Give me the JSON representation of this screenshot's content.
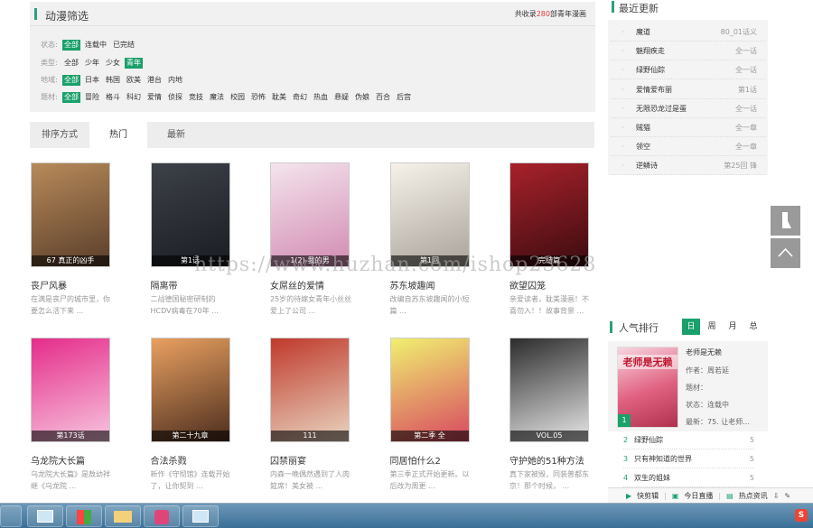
{
  "filter": {
    "title": "动漫筛选",
    "total_prefix": "共收录",
    "total_count": "280",
    "total_suffix": "部青年漫画",
    "rows": [
      {
        "label": "状态:",
        "options": [
          "全部",
          "连载中",
          "已完结"
        ],
        "selected": 0
      },
      {
        "label": "类型:",
        "options": [
          "全部",
          "少年",
          "少女",
          "青年"
        ],
        "selected": 3
      },
      {
        "label": "地域:",
        "options": [
          "全部",
          "日本",
          "韩国",
          "欧美",
          "港台",
          "内地"
        ],
        "selected": 0
      },
      {
        "label": "题材:",
        "options": [
          "全部",
          "冒险",
          "格斗",
          "科幻",
          "爱情",
          "侦探",
          "竞技",
          "魔法",
          "校园",
          "恐怖",
          "耽美",
          "奇幻",
          "热血",
          "悬疑",
          "伪娘",
          "百合",
          "后宫"
        ],
        "selected": 0
      }
    ]
  },
  "sort": {
    "label": "排序方式",
    "tabs": [
      "热门",
      "最新"
    ],
    "active": 0
  },
  "comics": [
    {
      "title": "丧尸风暴",
      "tag": "67 真正的凶手",
      "desc": "在满是丧尸的城市里，你要怎么活下来 ...",
      "colors": [
        "#b78a5a",
        "#5a3e2a"
      ]
    },
    {
      "title": "隔离带",
      "tag": "第1话",
      "desc": "二战德国秘密研制的HCDV病毒在70年 ...",
      "colors": [
        "#3d4148",
        "#1a1d22"
      ]
    },
    {
      "title": "女屌丝的爱情",
      "tag": "1(2)-我的男",
      "desc": "25岁的待嫁女青年小丝丝爱上了公司 ...",
      "colors": [
        "#f4e4ec",
        "#d28bb3"
      ]
    },
    {
      "title": "苏东坡趣闻",
      "tag": "第1回",
      "desc": "改编自苏东坡趣闻的小短篇 ...",
      "colors": [
        "#f6f2ea",
        "#a9a39a"
      ]
    },
    {
      "title": "欲望囚笼",
      "tag": "完结篇",
      "desc": "亲爱读者，耽美漫画！不喜勿入！！故事背景 ...",
      "colors": [
        "#a8212b",
        "#3b0c10"
      ]
    },
    {
      "title": "乌龙院大长篇",
      "tag": "第173话",
      "desc": "乌龙院大长篇》是敖幼祥继《乌龙院 ...",
      "colors": [
        "#e52c8a",
        "#f7c5de"
      ]
    },
    {
      "title": "合法杀戮",
      "tag": "第二十九章",
      "desc": "新作《守彻馆》连载开始了，让你契到 ...",
      "colors": [
        "#e9a060",
        "#4c2e1e"
      ]
    },
    {
      "title": "囚禁丽宴",
      "tag": "111",
      "desc": "内森一晚偶然遇到了人肉筵席！美女被 ...",
      "colors": [
        "#c0392b",
        "#e8d5c0"
      ]
    },
    {
      "title": "同居怕什么2",
      "tag": "第二季 全",
      "desc": "第三季正式开始更新。以后改为周更 ...",
      "colors": [
        "#f0f070",
        "#d84860"
      ]
    },
    {
      "title": "守护她的51种方法",
      "tag": "VOL.05",
      "desc": "真下家被毁，同装普都东京！那个时候， ...",
      "colors": [
        "#2c2c2c",
        "#e7e7e7"
      ]
    }
  ],
  "recent": {
    "title": "最近更新",
    "items": [
      {
        "name": "魔道",
        "ep": "80_01话义"
      },
      {
        "name": "魅翔疾走",
        "ep": "全一话"
      },
      {
        "name": "绿野仙踪",
        "ep": "全一话"
      },
      {
        "name": "爱情爱布丽",
        "ep": "第1话"
      },
      {
        "name": "无限恐龙过是蛋",
        "ep": "全一话"
      },
      {
        "name": "贼猫",
        "ep": "全一章"
      },
      {
        "name": "领空",
        "ep": "全一章"
      },
      {
        "name": "逆鳞诗",
        "ep": "第25回 锋"
      }
    ]
  },
  "rank": {
    "title": "人气排行",
    "tabs": [
      "日",
      "周",
      "月",
      "总"
    ],
    "active": 0,
    "top": {
      "rank": "1",
      "name": "老师是无赖",
      "author": "作者：周若延",
      "genre": "题材：",
      "status": "状态：连载中",
      "latest": "最新：75. 让老师..."
    },
    "rows": [
      {
        "num": "2",
        "name": "绿野仙踪",
        "val": "5"
      },
      {
        "num": "3",
        "name": "只有神知道的世界",
        "val": "5"
      },
      {
        "num": "4",
        "name": "双生的姐妹",
        "val": "5"
      }
    ]
  },
  "watermark": "https://www.huzhan.com/ishop23628",
  "bottom_bar": {
    "items": [
      "快剪辑",
      "今日直播",
      "热点资讯"
    ]
  },
  "tray_label": "S"
}
